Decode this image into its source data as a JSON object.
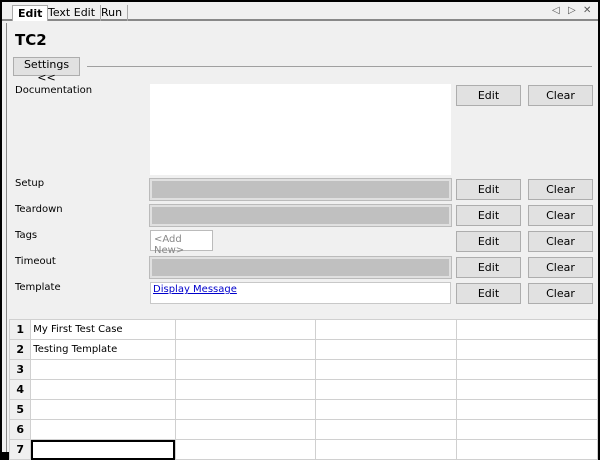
{
  "tabs": [
    {
      "label": "Edit",
      "active": true
    },
    {
      "label": "Text Edit"
    },
    {
      "label": "Run"
    }
  ],
  "tab_nav": {
    "prev": "◁",
    "next": "▷",
    "close": "✕"
  },
  "title": "TC2",
  "settings_toggle": "Settings <<",
  "buttons": {
    "edit": "Edit",
    "clear": "Clear"
  },
  "settings": {
    "documentation": {
      "label": "Documentation",
      "value": ""
    },
    "setup": {
      "label": "Setup",
      "value": ""
    },
    "teardown": {
      "label": "Teardown",
      "value": ""
    },
    "tags": {
      "label": "Tags",
      "placeholder": "<Add New>"
    },
    "timeout": {
      "label": "Timeout",
      "value": ""
    },
    "template": {
      "label": "Template",
      "value": "Display Message"
    }
  },
  "grid": {
    "rows": [
      {
        "num": "1",
        "cells": [
          "My First Test Case",
          "",
          "",
          ""
        ]
      },
      {
        "num": "2",
        "cells": [
          "Testing Template",
          "",
          "",
          ""
        ]
      },
      {
        "num": "3",
        "cells": [
          "",
          "",
          "",
          ""
        ]
      },
      {
        "num": "4",
        "cells": [
          "",
          "",
          "",
          ""
        ]
      },
      {
        "num": "5",
        "cells": [
          "",
          "",
          "",
          ""
        ]
      },
      {
        "num": "6",
        "cells": [
          "",
          "",
          "",
          ""
        ]
      },
      {
        "num": "7",
        "cells": [
          "",
          "",
          "",
          ""
        ]
      }
    ]
  }
}
